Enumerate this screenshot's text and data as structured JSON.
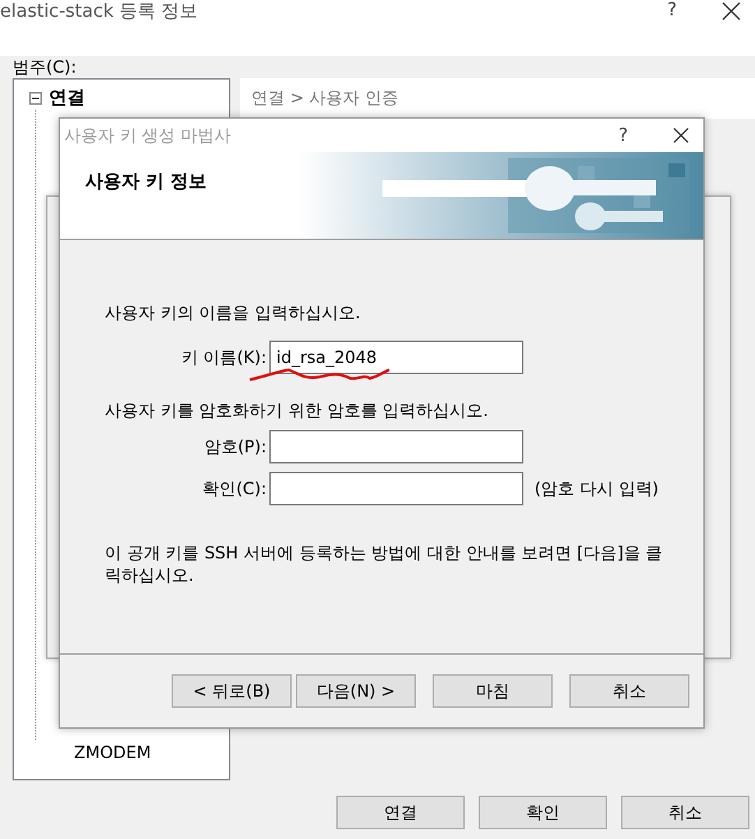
{
  "window": {
    "title": "elastic-stack 등록 정보",
    "help": "?"
  },
  "category_label": "범주(C):",
  "tree": {
    "groups": [
      {
        "label": "연결",
        "expanded": true
      }
    ],
    "leaves": [
      {
        "label": "ZMODEM"
      }
    ]
  },
  "breadcrumb": "연결 > 사용자 인증",
  "buttons": [
    "연결",
    "확인",
    "취소"
  ],
  "dialog": {
    "title": "사용자 키 생성 마법사",
    "help": "?",
    "header": "사용자 키 정보",
    "intro": "사용자 키의 이름을 입력하십시오.",
    "key_field": {
      "label": "키 이름(K):",
      "value": "id_rsa_2048"
    },
    "password_prompt": "사용자 키를 암호화하기 위한 암호를 입력하십시오.",
    "password_fields": [
      {
        "label": "암호(P):"
      },
      {
        "label": "확인(C):",
        "note": "(암호 다시 입력)"
      }
    ],
    "footer_text": "이 공개 키를 SSH 서버에 등록하는 방법에 대한 안내를 보려면 [다음]을 클릭하십시오.",
    "buttons": [
      "< 뒤로(B)",
      "다음(N) >",
      "마침",
      "취소"
    ]
  }
}
